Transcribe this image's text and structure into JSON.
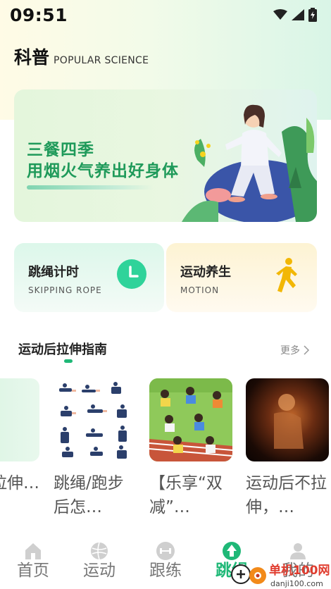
{
  "status_bar": {
    "time": "09:51"
  },
  "header": {
    "title": "科普",
    "subtitle": "POPULAR SCIENCE"
  },
  "banner": {
    "line1": "三餐四季",
    "line2": "用烟火气养出好身体"
  },
  "cards": [
    {
      "title": "跳绳计时",
      "subtitle": "SKIPPING ROPE",
      "icon": "clock-icon",
      "color": "#2fd39a"
    },
    {
      "title": "运动养生",
      "subtitle": "MOTION",
      "icon": "walking-person-icon",
      "color": "#f2b705"
    }
  ],
  "section": {
    "title": "运动后拉伸指南",
    "more": "更多"
  },
  "articles": [
    {
      "text": "后拉伸…"
    },
    {
      "text": "跳绳/跑步后怎…"
    },
    {
      "text": "【乐享“双减”…"
    },
    {
      "text": "运动后不拉伸，…"
    }
  ],
  "tabs": [
    {
      "label": "首页",
      "icon": "home-icon"
    },
    {
      "label": "运动",
      "icon": "ball-icon"
    },
    {
      "label": "跟练",
      "icon": "dumbbell-icon"
    },
    {
      "label": "跳绳",
      "icon": "tree-icon",
      "active": true
    },
    {
      "label": "我的",
      "icon": "user-icon"
    }
  ],
  "watermark": {
    "text": "单机100网",
    "url": "danji100.com"
  },
  "colors": {
    "accent": "#1fb877",
    "banner_text": "#1f9a5a"
  }
}
